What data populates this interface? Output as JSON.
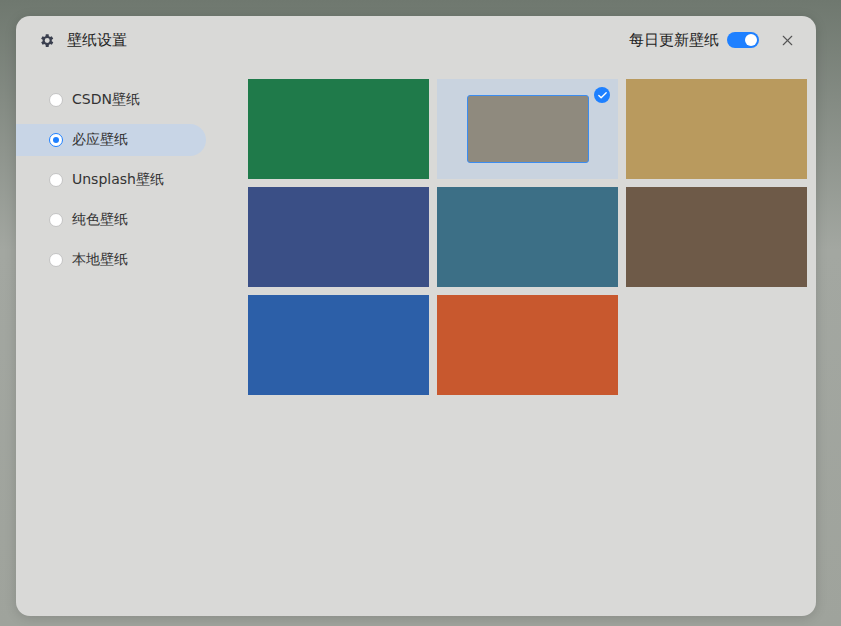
{
  "window": {
    "title": "壁纸设置"
  },
  "daily_update": {
    "label": "每日更新壁纸",
    "on": true
  },
  "sources": [
    {
      "label": "CSDN壁纸",
      "selected": false
    },
    {
      "label": "必应壁纸",
      "selected": true
    },
    {
      "label": "Unsplash壁纸",
      "selected": false
    },
    {
      "label": "纯色壁纸",
      "selected": false
    },
    {
      "label": "本地壁纸",
      "selected": false
    }
  ],
  "wallpapers": [
    {
      "selected": false,
      "color": "#1f7a4a"
    },
    {
      "selected": true,
      "color": "#8f8a7e"
    },
    {
      "selected": false,
      "color": "#b99a5e"
    },
    {
      "selected": false,
      "color": "#3a4f86"
    },
    {
      "selected": false,
      "color": "#3c6f86"
    },
    {
      "selected": false,
      "color": "#6e5a48"
    },
    {
      "selected": false,
      "color": "#2c5fa8"
    },
    {
      "selected": false,
      "color": "#c8582e"
    }
  ]
}
